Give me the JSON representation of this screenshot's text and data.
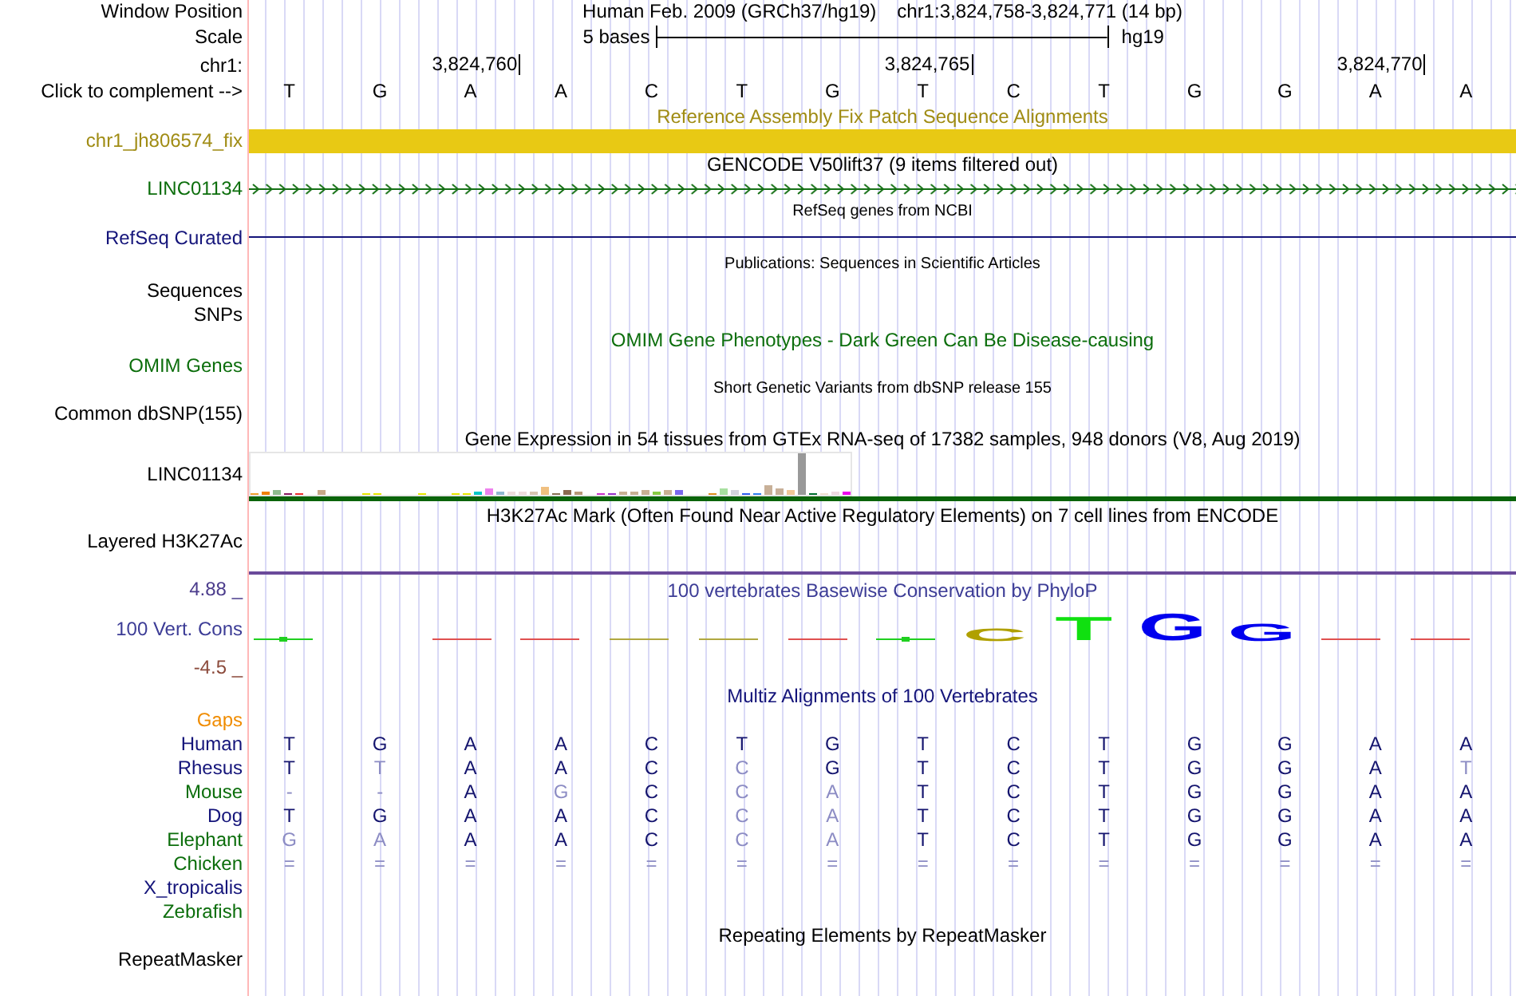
{
  "window_position": {
    "label": "Window Position",
    "assembly": "Human Feb. 2009 (GRCh37/hg19)",
    "range": "chr1:3,824,758-3,824,771 (14 bp)"
  },
  "scale": {
    "label": "Scale",
    "span": "5 bases",
    "assembly": "hg19"
  },
  "ruler": {
    "label": "chr1:",
    "positions": [
      "3,824,760",
      "3,824,765",
      "3,824,770"
    ]
  },
  "sequence": {
    "label": "Click to complement -->",
    "bases": [
      "T",
      "G",
      "A",
      "A",
      "C",
      "T",
      "G",
      "T",
      "C",
      "T",
      "G",
      "G",
      "A",
      "A"
    ]
  },
  "tracks": [
    {
      "kind": "fix_patch",
      "title": {
        "text": "Reference Assembly Fix Patch Sequence Alignments",
        "color": "#a08c14"
      },
      "labels": [
        {
          "text": "chr1_jh806574_fix",
          "color": "#a08c14"
        }
      ]
    },
    {
      "kind": "gene",
      "title": {
        "text": "GENCODE V50lift37 (9 items filtered out)",
        "color": "#000000"
      },
      "labels": [
        {
          "text": "LINC01134",
          "color": "#0c6e0c"
        }
      ]
    },
    {
      "kind": "refseq",
      "title": {
        "text": "RefSeq genes from NCBI",
        "color": "#000000"
      },
      "labels": [
        {
          "text": "RefSeq Curated",
          "color": "#14147a"
        }
      ]
    },
    {
      "kind": "publications",
      "title": {
        "text": "Publications: Sequences in Scientific Articles",
        "color": "#000000"
      },
      "labels": [
        {
          "text": "Sequences",
          "color": "#000000"
        },
        {
          "text": "SNPs",
          "color": "#000000"
        }
      ]
    },
    {
      "kind": "omim",
      "title": {
        "text": "OMIM Gene Phenotypes - Dark Green Can Be Disease-causing",
        "color": "#0c6e0c"
      },
      "labels": [
        {
          "text": "OMIM Genes",
          "color": "#0c6e0c"
        }
      ]
    },
    {
      "kind": "dbsnp",
      "title": {
        "text": "Short Genetic Variants from dbSNP release 155",
        "color": "#000000"
      },
      "labels": [
        {
          "text": "Common dbSNP(155)",
          "color": "#000000"
        }
      ]
    },
    {
      "kind": "gtex",
      "title": {
        "text": "Gene Expression in 54 tissues from GTEx RNA-seq of 17382 samples, 948 donors (V8, Aug 2019)",
        "color": "#000000"
      },
      "labels": [
        {
          "text": "LINC01134",
          "color": "#000000"
        }
      ]
    },
    {
      "kind": "encode",
      "title": {
        "text": "H3K27Ac Mark (Often Found Near Active Regulatory Elements) on 7 cell lines from ENCODE",
        "color": "#000000"
      },
      "labels": [
        {
          "text": "Layered H3K27Ac",
          "color": "#000000"
        }
      ]
    },
    {
      "kind": "phylop",
      "title": {
        "text": "100 vertebrates Basewise Conservation by PhyloP",
        "color": "#3c3c96"
      },
      "max": {
        "text": "4.88 _",
        "color": "#4b3c8c"
      },
      "labels": [
        {
          "text": "100 Vert. Cons",
          "color": "#3c3c96"
        }
      ],
      "min": {
        "text": "-4.5 _",
        "color": "#8c4b3c"
      },
      "logo": [
        {
          "kind": "tick",
          "color": "#20d020"
        },
        {
          "kind": "empty"
        },
        {
          "kind": "dash",
          "color": "#e05050"
        },
        {
          "kind": "dash",
          "color": "#e05050"
        },
        {
          "kind": "dash",
          "color": "#b0a840"
        },
        {
          "kind": "dash",
          "color": "#b0a840"
        },
        {
          "kind": "dash",
          "color": "#e05050"
        },
        {
          "kind": "tick",
          "color": "#20d020"
        },
        {
          "kind": "letter",
          "letter": "C",
          "color": "#b0a000"
        },
        {
          "kind": "letter",
          "letter": "T",
          "color": "#10e010"
        },
        {
          "kind": "letter",
          "letter": "G",
          "color": "#0000ee"
        },
        {
          "kind": "letter",
          "letter": "G",
          "color": "#0000ee"
        },
        {
          "kind": "dash",
          "color": "#e05050"
        },
        {
          "kind": "dash",
          "color": "#e05050"
        }
      ]
    },
    {
      "kind": "multiz",
      "title": {
        "text": "Multiz Alignments of 100 Vertebrates",
        "color": "#14147a"
      },
      "labels": [
        {
          "text": "Gaps",
          "color": "#f08c00"
        }
      ],
      "species": [
        {
          "name": "Human",
          "color": "#14147a",
          "bases": [
            {
              "letter": "T",
              "mismatch": false
            },
            {
              "letter": "G",
              "mismatch": false
            },
            {
              "letter": "A",
              "mismatch": false
            },
            {
              "letter": "A",
              "mismatch": false
            },
            {
              "letter": "C",
              "mismatch": false
            },
            {
              "letter": "T",
              "mismatch": false
            },
            {
              "letter": "G",
              "mismatch": false
            },
            {
              "letter": "T",
              "mismatch": false
            },
            {
              "letter": "C",
              "mismatch": false
            },
            {
              "letter": "T",
              "mismatch": false
            },
            {
              "letter": "G",
              "mismatch": false
            },
            {
              "letter": "G",
              "mismatch": false
            },
            {
              "letter": "A",
              "mismatch": false
            },
            {
              "letter": "A",
              "mismatch": false
            }
          ]
        },
        {
          "name": "Rhesus",
          "color": "#14147a",
          "bases": [
            {
              "letter": "T",
              "mismatch": false
            },
            {
              "letter": "T",
              "mismatch": true
            },
            {
              "letter": "A",
              "mismatch": false
            },
            {
              "letter": "A",
              "mismatch": false
            },
            {
              "letter": "C",
              "mismatch": false
            },
            {
              "letter": "C",
              "mismatch": true
            },
            {
              "letter": "G",
              "mismatch": false
            },
            {
              "letter": "T",
              "mismatch": false
            },
            {
              "letter": "C",
              "mismatch": false
            },
            {
              "letter": "T",
              "mismatch": false
            },
            {
              "letter": "G",
              "mismatch": false
            },
            {
              "letter": "G",
              "mismatch": false
            },
            {
              "letter": "A",
              "mismatch": false
            },
            {
              "letter": "T",
              "mismatch": true
            }
          ]
        },
        {
          "name": "Mouse",
          "color": "#0c6e0c",
          "bases": [
            {
              "letter": "-",
              "mismatch": true
            },
            {
              "letter": "-",
              "mismatch": true
            },
            {
              "letter": "A",
              "mismatch": false
            },
            {
              "letter": "G",
              "mismatch": true
            },
            {
              "letter": "C",
              "mismatch": false
            },
            {
              "letter": "C",
              "mismatch": true
            },
            {
              "letter": "A",
              "mismatch": true
            },
            {
              "letter": "T",
              "mismatch": false
            },
            {
              "letter": "C",
              "mismatch": false
            },
            {
              "letter": "T",
              "mismatch": false
            },
            {
              "letter": "G",
              "mismatch": false
            },
            {
              "letter": "G",
              "mismatch": false
            },
            {
              "letter": "A",
              "mismatch": false
            },
            {
              "letter": "A",
              "mismatch": false
            }
          ]
        },
        {
          "name": "Dog",
          "color": "#14147a",
          "bases": [
            {
              "letter": "T",
              "mismatch": false
            },
            {
              "letter": "G",
              "mismatch": false
            },
            {
              "letter": "A",
              "mismatch": false
            },
            {
              "letter": "A",
              "mismatch": false
            },
            {
              "letter": "C",
              "mismatch": false
            },
            {
              "letter": "C",
              "mismatch": true
            },
            {
              "letter": "A",
              "mismatch": true
            },
            {
              "letter": "T",
              "mismatch": false
            },
            {
              "letter": "C",
              "mismatch": false
            },
            {
              "letter": "T",
              "mismatch": false
            },
            {
              "letter": "G",
              "mismatch": false
            },
            {
              "letter": "G",
              "mismatch": false
            },
            {
              "letter": "A",
              "mismatch": false
            },
            {
              "letter": "A",
              "mismatch": false
            }
          ]
        },
        {
          "name": "Elephant",
          "color": "#0c6e0c",
          "bases": [
            {
              "letter": "G",
              "mismatch": true
            },
            {
              "letter": "A",
              "mismatch": true
            },
            {
              "letter": "A",
              "mismatch": false
            },
            {
              "letter": "A",
              "mismatch": false
            },
            {
              "letter": "C",
              "mismatch": false
            },
            {
              "letter": "C",
              "mismatch": true
            },
            {
              "letter": "A",
              "mismatch": true
            },
            {
              "letter": "T",
              "mismatch": false
            },
            {
              "letter": "C",
              "mismatch": false
            },
            {
              "letter": "T",
              "mismatch": false
            },
            {
              "letter": "G",
              "mismatch": false
            },
            {
              "letter": "G",
              "mismatch": false
            },
            {
              "letter": "A",
              "mismatch": false
            },
            {
              "letter": "A",
              "mismatch": false
            }
          ]
        },
        {
          "name": "Chicken",
          "color": "#0c6e0c",
          "bases": [
            {
              "letter": "=",
              "mismatch": true
            },
            {
              "letter": "=",
              "mismatch": true
            },
            {
              "letter": "=",
              "mismatch": true
            },
            {
              "letter": "=",
              "mismatch": true
            },
            {
              "letter": "=",
              "mismatch": true
            },
            {
              "letter": "=",
              "mismatch": true
            },
            {
              "letter": "=",
              "mismatch": true
            },
            {
              "letter": "=",
              "mismatch": true
            },
            {
              "letter": "=",
              "mismatch": true
            },
            {
              "letter": "=",
              "mismatch": true
            },
            {
              "letter": "=",
              "mismatch": true
            },
            {
              "letter": "=",
              "mismatch": true
            },
            {
              "letter": "=",
              "mismatch": true
            },
            {
              "letter": "=",
              "mismatch": true
            }
          ]
        },
        {
          "name": "X_tropicalis",
          "color": "#14147a"
        },
        {
          "name": "Zebrafish",
          "color": "#0c6e0c"
        }
      ]
    },
    {
      "kind": "repeats",
      "title": {
        "text": "Repeating Elements by RepeatMasker",
        "color": "#000000"
      },
      "labels": [
        {
          "text": "RepeatMasker",
          "color": "#000000"
        }
      ]
    }
  ]
}
